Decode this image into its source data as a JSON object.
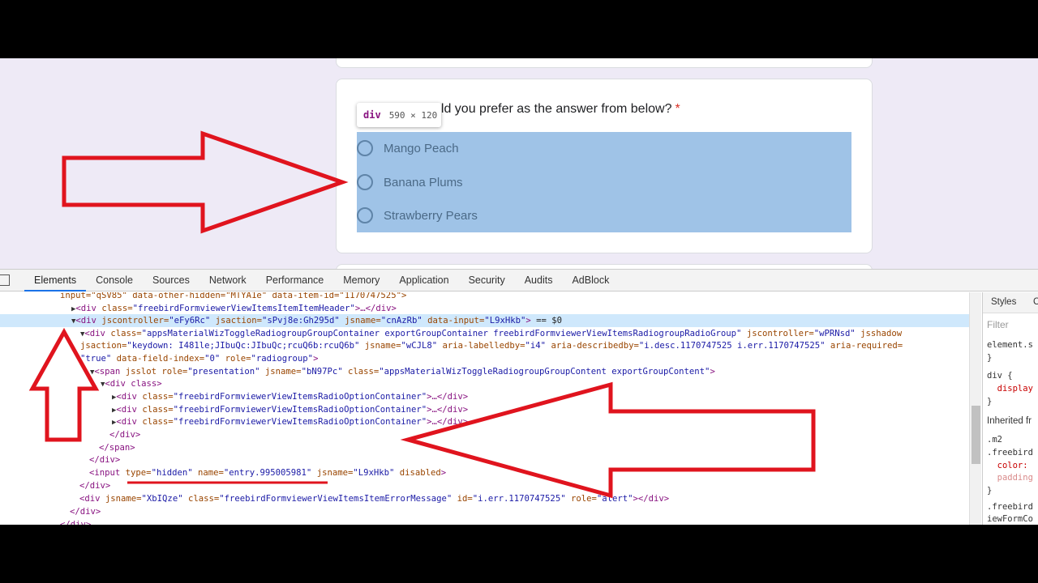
{
  "form": {
    "question_text": "uld you prefer as the answer from below?",
    "required_mark": "*",
    "options": [
      "Mango Peach",
      "Banana Plums",
      "Strawberry Pears"
    ],
    "tooltip_tag": "div",
    "tooltip_dims": "590 × 120"
  },
  "devtools": {
    "tabs": [
      "Elements",
      "Console",
      "Sources",
      "Network",
      "Performance",
      "Memory",
      "Application",
      "Security",
      "Audits",
      "AdBlock"
    ],
    "active_tab": "Elements",
    "styles_tab": "Styles",
    "styles_tab_partial": "C",
    "filter_placeholder": "Filter",
    "styles_lines": [
      "element.s",
      "}",
      "div {",
      "  display",
      "}",
      "Inherited fr",
      ".m2",
      ".freebird",
      "  color:",
      "  padding",
      "}",
      ".freebird",
      "iewFormCo"
    ]
  },
  "dom": {
    "l0_text": "input=\"qSV85\" data-other-hidden=\"MTYA1e\" data-item-id=\"1170747525\">",
    "l1_tag": "<div",
    "l1_attr": " class=",
    "l1_val": "\"freebirdFormviewerViewItemsItemItemHeader\"",
    "l1_end": ">…</div>",
    "l2_tag": "<div",
    "l2_a1": " jscontroller=",
    "l2_v1": "\"eFy6Rc\"",
    "l2_a2": " jsaction=",
    "l2_v2": "\"sPvj8e:Gh295d\"",
    "l2_a3": " jsname=",
    "l2_v3": "\"cnAzRb\"",
    "l2_a4": " data-input=",
    "l2_v4": "\"L9xHkb\"",
    "l2_end": ">",
    "l2_eq": " == $0",
    "l3_tag": "<div",
    "l3_a1": " class=",
    "l3_v1": "\"appsMaterialWizToggleRadiogroupGroupContainer exportGroupContainer freebirdFormviewerViewItemsRadiogroupRadioGroup\"",
    "l3_a2": " jscontroller=",
    "l3_v2": "\"wPRNsd\"",
    "l3_a3": " jsshadow",
    "l4_a1": "jsaction=",
    "l4_v1": "\"keydown: I481le;JIbuQc:JIbuQc;rcuQ6b:rcuQ6b\"",
    "l4_a2": " jsname=",
    "l4_v2": "\"wCJL8\"",
    "l4_a3": " aria-labelledby=",
    "l4_v3": "\"i4\"",
    "l4_a4": " aria-describedby=",
    "l4_v4": "\"i.desc.1170747525 i.err.1170747525\"",
    "l4_a5": " aria-required=",
    "l5_v1": "\"true\"",
    "l5_a1": " data-field-index=",
    "l5_v2": "\"0\"",
    "l5_a2": " role=",
    "l5_v3": "\"radiogroup\"",
    "l5_end": ">",
    "l6_tag": "<span",
    "l6_a1": " jsslot role=",
    "l6_v1": "\"presentation\"",
    "l6_a2": " jsname=",
    "l6_v2": "\"bN97Pc\"",
    "l6_a3": " class=",
    "l6_v3": "\"appsMaterialWizToggleRadiogroupGroupContent exportGroupContent\"",
    "l6_end": ">",
    "l7_text": "<div class>",
    "opt_tag": "<div",
    "opt_attr": " class=",
    "opt_val": "\"freebirdFormviewerViewItemsRadioOptionContainer\"",
    "opt_end": ">…</div>",
    "close_div": "</div>",
    "close_span": "</span>",
    "inp_tag": "<input",
    "inp_a1": " type=",
    "inp_v1": "\"hidden\"",
    "inp_a2": " name=",
    "inp_v2": "\"entry.995005981\"",
    "inp_a3": " jsname=",
    "inp_v3": "\"L9xHkb\"",
    "inp_a4": " disabled",
    "inp_end": ">",
    "err_tag": "<div",
    "err_a1": " jsname=",
    "err_v1": "\"XbIQze\"",
    "err_a2": " class=",
    "err_v2": "\"freebirdFormviewerViewItemsItemErrorMessage\"",
    "err_a3": " id=",
    "err_v3": "\"i.err.1170747525\"",
    "err_a4": " role=",
    "err_v4": "\"alert\"",
    "err_end": "></div>",
    "last_text": "</div>"
  },
  "colors": {
    "annotation_red": "#e0141e",
    "highlight_blue": "#9fc3e7",
    "selected_row": "#cfe8fc"
  }
}
